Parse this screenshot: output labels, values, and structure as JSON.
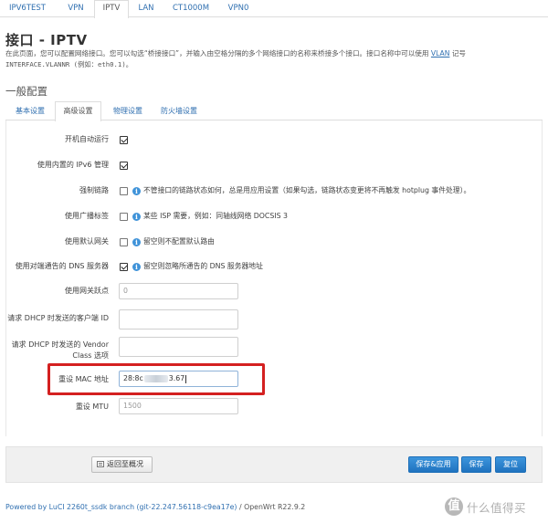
{
  "top_tabs": [
    "IPV6TEST",
    "VPN",
    "IPTV",
    "LAN",
    "CT1000M",
    "VPN0"
  ],
  "active_top_tab": "IPTV",
  "page_title": "接口 - IPTV",
  "description": {
    "line1_prefix": "在此页面，您可以配置网络接口。您可以勾选“桥接接口”，并输入由空格分隔的多个网络接口的名称来桥接多个接口。接口名称中可以使用",
    "line1_link": "VLAN",
    "line1_suffix": "记号",
    "line2": "INTERFACE.VLANNR (例如：eth0.1)。"
  },
  "section_title": "一般配置",
  "sub_tabs": [
    "基本设置",
    "高级设置",
    "物理设置",
    "防火墙设置"
  ],
  "active_sub_tab": "高级设置",
  "rows": {
    "auto_start": {
      "label": "开机自动运行",
      "checked": true
    },
    "builtin_ipv6": {
      "label": "使用内置的 IPv6 管理",
      "checked": true
    },
    "force_link": {
      "label": "强制链路",
      "checked": false,
      "help": "不管接口的链路状态如何，总是用应用设置（如果勾选，链路状态变更将不再触发 hotplug 事件处理）。"
    },
    "broadcast_flag": {
      "label": "使用广播标签",
      "checked": false,
      "help": "某些 ISP 需要，例如：同轴线网络 DOCSIS 3"
    },
    "default_gateway": {
      "label": "使用默认网关",
      "checked": false,
      "help": "留空则不配置默认路由"
    },
    "peer_dns": {
      "label": "使用对端通告的 DNS 服务器",
      "checked": true,
      "help": "留空则忽略所通告的 DNS 服务器地址"
    },
    "gateway_metric": {
      "label": "使用网关跃点",
      "placeholder": "0"
    },
    "dhcp_client_id": {
      "label": "请求 DHCP 时发送的客户端 ID",
      "value": ""
    },
    "dhcp_vendor_class": {
      "label": "请求 DHCP 时发送的 Vendor Class 选项",
      "value": ""
    },
    "override_mac": {
      "label": "重设 MAC 地址",
      "value_start": "28:8c",
      "value_end": "3.67"
    },
    "override_mtu": {
      "label": "重设 MTU",
      "placeholder": "1500"
    }
  },
  "buttons": {
    "back": "返回至概况",
    "save_apply": "保存&应用",
    "save": "保存",
    "reset": "复位"
  },
  "footer": {
    "link": "Powered by LuCI 2260t_ssdk branch (git-22.247.56118-c9ea17e)",
    "separator": " / ",
    "version": "OpenWrt R22.9.2"
  },
  "watermark": {
    "logo": "值",
    "text": "什么值得买"
  },
  "colors": {
    "accent_blue": "#1f73bf",
    "link_blue": "#2f6fb0",
    "highlight_red": "#d42020"
  }
}
